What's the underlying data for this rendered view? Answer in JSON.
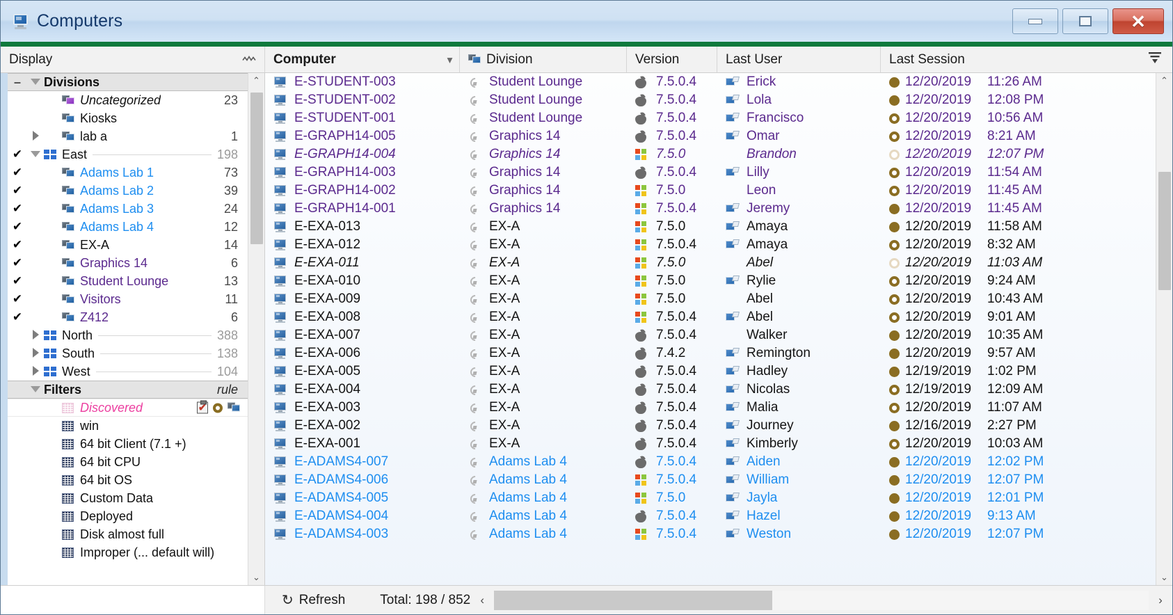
{
  "window": {
    "title": "Computers",
    "icon": "computer-monitor-icon",
    "controls": {
      "minimize": "–",
      "maximize": "□",
      "close": "✕"
    },
    "accent_green": "#0f7a3d"
  },
  "columns": {
    "display": "Display",
    "computer": "Computer",
    "division": "Division",
    "version": "Version",
    "last_user": "Last User",
    "last_session": "Last Session"
  },
  "sidebar": {
    "divisions_header": {
      "label": "Divisions",
      "count": ""
    },
    "filters_header": {
      "label": "Filters",
      "count": "rule"
    },
    "items": [
      {
        "label": "Uncategorized",
        "count": "23",
        "indent": 2,
        "icon": "purple-monitor-icon",
        "style": "ital",
        "checked": false,
        "expander": ""
      },
      {
        "label": "Kiosks",
        "count": "",
        "indent": 2,
        "icon": "monitor-pair-icon",
        "style": "",
        "checked": false,
        "expander": ""
      },
      {
        "label": "lab a",
        "count": "1",
        "indent": 2,
        "icon": "monitor-pair-icon",
        "style": "",
        "checked": false,
        "expander": "right"
      },
      {
        "label": "East",
        "count": "198",
        "indent": 1,
        "icon": "group-tiles-icon",
        "style": "",
        "checked": true,
        "expander": "down",
        "dim": true
      },
      {
        "label": "Adams Lab 1",
        "count": "73",
        "indent": 2,
        "icon": "monitor-pair-icon",
        "style": "blue",
        "checked": true,
        "expander": ""
      },
      {
        "label": "Adams Lab 2",
        "count": "39",
        "indent": 2,
        "icon": "monitor-pair-icon",
        "style": "blue",
        "checked": true,
        "expander": ""
      },
      {
        "label": "Adams Lab 3",
        "count": "24",
        "indent": 2,
        "icon": "monitor-pair-icon",
        "style": "blue",
        "checked": true,
        "expander": ""
      },
      {
        "label": "Adams Lab 4",
        "count": "12",
        "indent": 2,
        "icon": "monitor-pair-icon",
        "style": "blue",
        "checked": true,
        "expander": ""
      },
      {
        "label": "EX-A",
        "count": "14",
        "indent": 2,
        "icon": "monitor-pair-icon",
        "style": "",
        "checked": true,
        "expander": ""
      },
      {
        "label": "Graphics 14",
        "count": "6",
        "indent": 2,
        "icon": "monitor-pair-icon",
        "style": "purple",
        "checked": true,
        "expander": ""
      },
      {
        "label": "Student Lounge",
        "count": "13",
        "indent": 2,
        "icon": "monitor-pair-icon",
        "style": "purple",
        "checked": true,
        "expander": ""
      },
      {
        "label": "Visitors",
        "count": "11",
        "indent": 2,
        "icon": "monitor-pair-icon",
        "style": "purple",
        "checked": true,
        "expander": ""
      },
      {
        "label": "Z412",
        "count": "6",
        "indent": 2,
        "icon": "monitor-pair-icon",
        "style": "purple",
        "checked": true,
        "expander": ""
      },
      {
        "label": "North",
        "count": "388",
        "indent": 1,
        "icon": "group-tiles-icon",
        "style": "",
        "checked": false,
        "expander": "right",
        "dim": true
      },
      {
        "label": "South",
        "count": "138",
        "indent": 1,
        "icon": "group-tiles-icon",
        "style": "",
        "checked": false,
        "expander": "right",
        "dim": true
      },
      {
        "label": "West",
        "count": "104",
        "indent": 1,
        "icon": "group-tiles-icon",
        "style": "",
        "checked": false,
        "expander": "right",
        "dim": true
      }
    ],
    "filters": [
      {
        "label": "Discovered",
        "icon": "grid-icon-pink",
        "style": "pink",
        "badges": [
          "clipboard-check-icon",
          "ring-icon",
          "monitor-pair-icon"
        ]
      },
      {
        "label": "win",
        "icon": "grid-icon",
        "style": ""
      },
      {
        "label": "64 bit Client (7.1 +)",
        "icon": "grid-icon",
        "style": ""
      },
      {
        "label": "64 bit CPU",
        "icon": "grid-icon",
        "style": ""
      },
      {
        "label": "64 bit OS",
        "icon": "grid-icon",
        "style": ""
      },
      {
        "label": "Custom Data",
        "icon": "grid-icon",
        "style": ""
      },
      {
        "label": "Deployed",
        "icon": "grid-icon",
        "style": ""
      },
      {
        "label": "Disk almost full",
        "icon": "grid-icon",
        "style": ""
      },
      {
        "label": "Improper (... default will)",
        "icon": "grid-icon",
        "style": ""
      }
    ]
  },
  "table": {
    "rows": [
      {
        "computer": "E-STUDENT-003",
        "division": "Student Lounge",
        "version": "7.5.0.4",
        "os": "apple",
        "user": "Erick",
        "user_icon": true,
        "date": "12/20/2019",
        "time": "11:26 AM",
        "status": "filled",
        "color": "purple",
        "italic": false
      },
      {
        "computer": "E-STUDENT-002",
        "division": "Student Lounge",
        "version": "7.5.0.4",
        "os": "apple",
        "user": "Lola",
        "user_icon": true,
        "date": "12/20/2019",
        "time": "12:08 PM",
        "status": "filled",
        "color": "purple",
        "italic": false
      },
      {
        "computer": "E-STUDENT-001",
        "division": "Student Lounge",
        "version": "7.5.0.4",
        "os": "apple",
        "user": "Francisco",
        "user_icon": true,
        "date": "12/20/2019",
        "time": "10:56 AM",
        "status": "ring",
        "color": "purple",
        "italic": false
      },
      {
        "computer": "E-GRAPH14-005",
        "division": "Graphics 14",
        "version": "7.5.0.4",
        "os": "apple",
        "user": "Omar",
        "user_icon": true,
        "date": "12/20/2019",
        "time": "8:21 AM",
        "status": "ring",
        "color": "purple",
        "italic": false
      },
      {
        "computer": "E-GRAPH14-004",
        "division": "Graphics 14",
        "version": "7.5.0",
        "os": "windows",
        "user": "Brandon",
        "user_icon": false,
        "date": "12/20/2019",
        "time": "12:07 PM",
        "status": "pale",
        "color": "purple",
        "italic": true
      },
      {
        "computer": "E-GRAPH14-003",
        "division": "Graphics 14",
        "version": "7.5.0.4",
        "os": "apple",
        "user": "Lilly",
        "user_icon": true,
        "date": "12/20/2019",
        "time": "11:54 AM",
        "status": "ring",
        "color": "purple",
        "italic": false
      },
      {
        "computer": "E-GRAPH14-002",
        "division": "Graphics 14",
        "version": "7.5.0",
        "os": "windows",
        "user": "Leon",
        "user_icon": false,
        "date": "12/20/2019",
        "time": "11:45 AM",
        "status": "ring",
        "color": "purple",
        "italic": false
      },
      {
        "computer": "E-GRAPH14-001",
        "division": "Graphics 14",
        "version": "7.5.0.4",
        "os": "windows",
        "user": "Jeremy",
        "user_icon": true,
        "date": "12/20/2019",
        "time": "11:45 AM",
        "status": "filled",
        "color": "purple",
        "italic": false
      },
      {
        "computer": "E-EXA-013",
        "division": "EX-A",
        "version": "7.5.0",
        "os": "windows",
        "user": "Amaya",
        "user_icon": true,
        "date": "12/20/2019",
        "time": "11:58 AM",
        "status": "filled",
        "color": "black",
        "italic": false
      },
      {
        "computer": "E-EXA-012",
        "division": "EX-A",
        "version": "7.5.0.4",
        "os": "windows",
        "user": "Amaya",
        "user_icon": true,
        "date": "12/20/2019",
        "time": "8:32 AM",
        "status": "ring",
        "color": "black",
        "italic": false
      },
      {
        "computer": "E-EXA-011",
        "division": "EX-A",
        "version": "7.5.0",
        "os": "windows",
        "user": "Abel",
        "user_icon": false,
        "date": "12/20/2019",
        "time": "11:03 AM",
        "status": "pale",
        "color": "black",
        "italic": true
      },
      {
        "computer": "E-EXA-010",
        "division": "EX-A",
        "version": "7.5.0",
        "os": "windows",
        "user": "Rylie",
        "user_icon": true,
        "date": "12/20/2019",
        "time": "9:24 AM",
        "status": "ring",
        "color": "black",
        "italic": false
      },
      {
        "computer": "E-EXA-009",
        "division": "EX-A",
        "version": "7.5.0",
        "os": "windows",
        "user": "Abel",
        "user_icon": false,
        "date": "12/20/2019",
        "time": "10:43 AM",
        "status": "ring",
        "color": "black",
        "italic": false
      },
      {
        "computer": "E-EXA-008",
        "division": "EX-A",
        "version": "7.5.0.4",
        "os": "windows",
        "user": "Abel",
        "user_icon": true,
        "date": "12/20/2019",
        "time": "9:01 AM",
        "status": "ring",
        "color": "black",
        "italic": false
      },
      {
        "computer": "E-EXA-007",
        "division": "EX-A",
        "version": "7.5.0.4",
        "os": "apple",
        "user": "Walker",
        "user_icon": false,
        "date": "12/20/2019",
        "time": "10:35 AM",
        "status": "filled",
        "color": "black",
        "italic": false
      },
      {
        "computer": "E-EXA-006",
        "division": "EX-A",
        "version": "7.4.2",
        "os": "apple",
        "user": "Remington",
        "user_icon": true,
        "date": "12/20/2019",
        "time": "9:57 AM",
        "status": "filled",
        "color": "black",
        "italic": false
      },
      {
        "computer": "E-EXA-005",
        "division": "EX-A",
        "version": "7.5.0.4",
        "os": "apple",
        "user": "Hadley",
        "user_icon": true,
        "date": "12/19/2019",
        "time": "1:02 PM",
        "status": "filled",
        "color": "black",
        "italic": false
      },
      {
        "computer": "E-EXA-004",
        "division": "EX-A",
        "version": "7.5.0.4",
        "os": "apple",
        "user": "Nicolas",
        "user_icon": true,
        "date": "12/19/2019",
        "time": "12:09 AM",
        "status": "ring",
        "color": "black",
        "italic": false
      },
      {
        "computer": "E-EXA-003",
        "division": "EX-A",
        "version": "7.5.0.4",
        "os": "apple",
        "user": "Malia",
        "user_icon": true,
        "date": "12/20/2019",
        "time": "11:07 AM",
        "status": "ring",
        "color": "black",
        "italic": false
      },
      {
        "computer": "E-EXA-002",
        "division": "EX-A",
        "version": "7.5.0.4",
        "os": "apple",
        "user": "Journey",
        "user_icon": true,
        "date": "12/16/2019",
        "time": "2:27 PM",
        "status": "filled",
        "color": "black",
        "italic": false
      },
      {
        "computer": "E-EXA-001",
        "division": "EX-A",
        "version": "7.5.0.4",
        "os": "apple",
        "user": "Kimberly",
        "user_icon": true,
        "date": "12/20/2019",
        "time": "10:03 AM",
        "status": "ring",
        "color": "black",
        "italic": false
      },
      {
        "computer": "E-ADAMS4-007",
        "division": "Adams Lab 4",
        "version": "7.5.0.4",
        "os": "apple",
        "user": "Aiden",
        "user_icon": true,
        "date": "12/20/2019",
        "time": "12:02 PM",
        "status": "filled",
        "color": "blue",
        "italic": false
      },
      {
        "computer": "E-ADAMS4-006",
        "division": "Adams Lab 4",
        "version": "7.5.0.4",
        "os": "windows",
        "user": "William",
        "user_icon": true,
        "date": "12/20/2019",
        "time": "12:07 PM",
        "status": "filled",
        "color": "blue",
        "italic": false
      },
      {
        "computer": "E-ADAMS4-005",
        "division": "Adams Lab 4",
        "version": "7.5.0",
        "os": "windows",
        "user": "Jayla",
        "user_icon": true,
        "date": "12/20/2019",
        "time": "12:01 PM",
        "status": "filled",
        "color": "blue",
        "italic": false
      },
      {
        "computer": "E-ADAMS4-004",
        "division": "Adams Lab 4",
        "version": "7.5.0.4",
        "os": "apple",
        "user": "Hazel",
        "user_icon": true,
        "date": "12/20/2019",
        "time": "9:13 AM",
        "status": "filled",
        "color": "blue",
        "italic": false
      },
      {
        "computer": "E-ADAMS4-003",
        "division": "Adams Lab 4",
        "version": "7.5.0.4",
        "os": "windows",
        "user": "Weston",
        "user_icon": true,
        "date": "12/20/2019",
        "time": "12:07 PM",
        "status": "filled",
        "color": "blue",
        "italic": false
      }
    ]
  },
  "statusbar": {
    "refresh_label": "Refresh",
    "refresh_icon": "refresh-icon",
    "total_label": "Total: 198 / 852",
    "scroll_left": "‹",
    "scroll_right": "›"
  }
}
